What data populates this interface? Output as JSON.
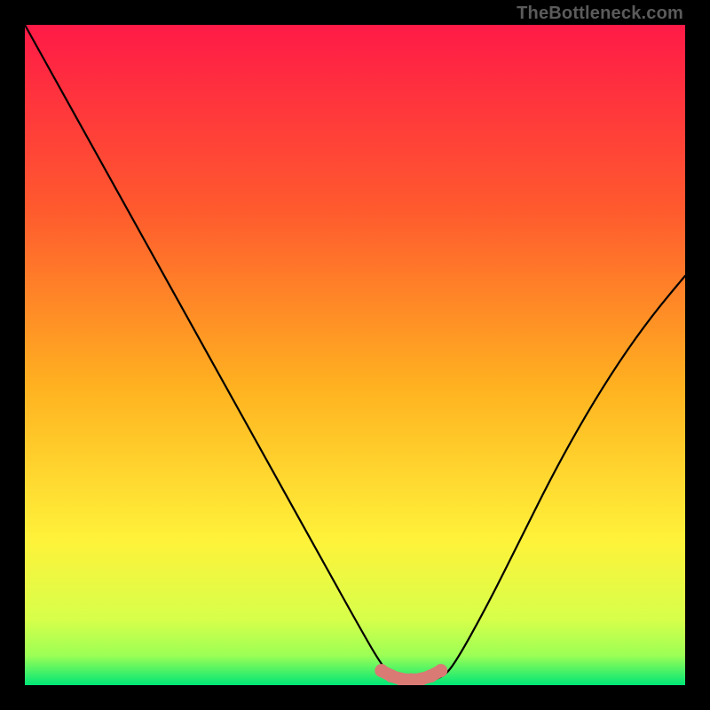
{
  "watermark": "TheBottleneck.com",
  "colors": {
    "frame": "#000000",
    "gradient_top": "#ff1a47",
    "gradient_mid1": "#ff6a2b",
    "gradient_mid2": "#ffd21f",
    "gradient_mid3": "#f4ff3a",
    "gradient_bottom": "#00e676",
    "curve": "#000000",
    "marker": "#d97a74"
  },
  "chart_data": {
    "type": "line",
    "title": "",
    "xlabel": "",
    "ylabel": "",
    "xlim": [
      0,
      100
    ],
    "ylim": [
      0,
      100
    ],
    "grid": false,
    "legend": false,
    "series": [
      {
        "name": "bottleneck-curve",
        "x": [
          0,
          5,
          10,
          15,
          20,
          25,
          30,
          35,
          40,
          45,
          50,
          54,
          56,
          58,
          60,
          63,
          65,
          70,
          75,
          80,
          85,
          90,
          95,
          100
        ],
        "y": [
          100,
          91,
          82,
          73,
          64,
          55,
          46,
          37,
          28,
          19,
          10,
          3,
          1,
          0.5,
          0.5,
          1,
          3,
          12,
          22,
          32,
          41,
          49,
          56,
          62
        ]
      }
    ],
    "markers": {
      "name": "minimum-band",
      "x": [
        54,
        55.5,
        57,
        58.5,
        60,
        61.5,
        63
      ],
      "y": [
        2.2,
        1.4,
        0.9,
        0.8,
        0.9,
        1.4,
        2.2
      ]
    },
    "gradient_stops": [
      {
        "offset": 0.0,
        "color": "#ff1a47"
      },
      {
        "offset": 0.28,
        "color": "#ff5a2e"
      },
      {
        "offset": 0.55,
        "color": "#ffb220"
      },
      {
        "offset": 0.78,
        "color": "#fff23a"
      },
      {
        "offset": 0.9,
        "color": "#d7ff4a"
      },
      {
        "offset": 0.955,
        "color": "#9cff55"
      },
      {
        "offset": 1.0,
        "color": "#00e676"
      }
    ]
  }
}
